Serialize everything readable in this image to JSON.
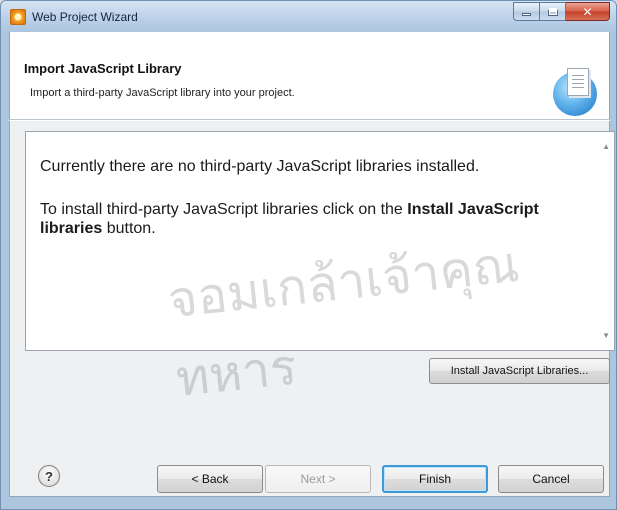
{
  "window": {
    "title": "Web Project Wizard",
    "icon": "wizard-app-icon"
  },
  "header": {
    "title": "Import JavaScript Library",
    "description": "Import a third-party JavaScript library into your project.",
    "icon": "library-document-icon"
  },
  "content": {
    "message_line1": "Currently there are no third-party JavaScript libraries installed.",
    "message_line2_prefix": "To install third-party JavaScript libraries click on the ",
    "message_line2_bold": "Install JavaScript libraries",
    "message_line2_suffix": " button."
  },
  "buttons": {
    "install": "Install JavaScript Libraries...",
    "help": "?",
    "back": "< Back",
    "next": "Next >",
    "finish": "Finish",
    "cancel": "Cancel"
  },
  "watermark": {
    "text": "จอมเกล้าเจ้าคุณทหาร"
  },
  "colors": {
    "title_bar": "#bcd1e8",
    "close_button": "#c2412a",
    "default_button_border": "#3d9ad6"
  }
}
